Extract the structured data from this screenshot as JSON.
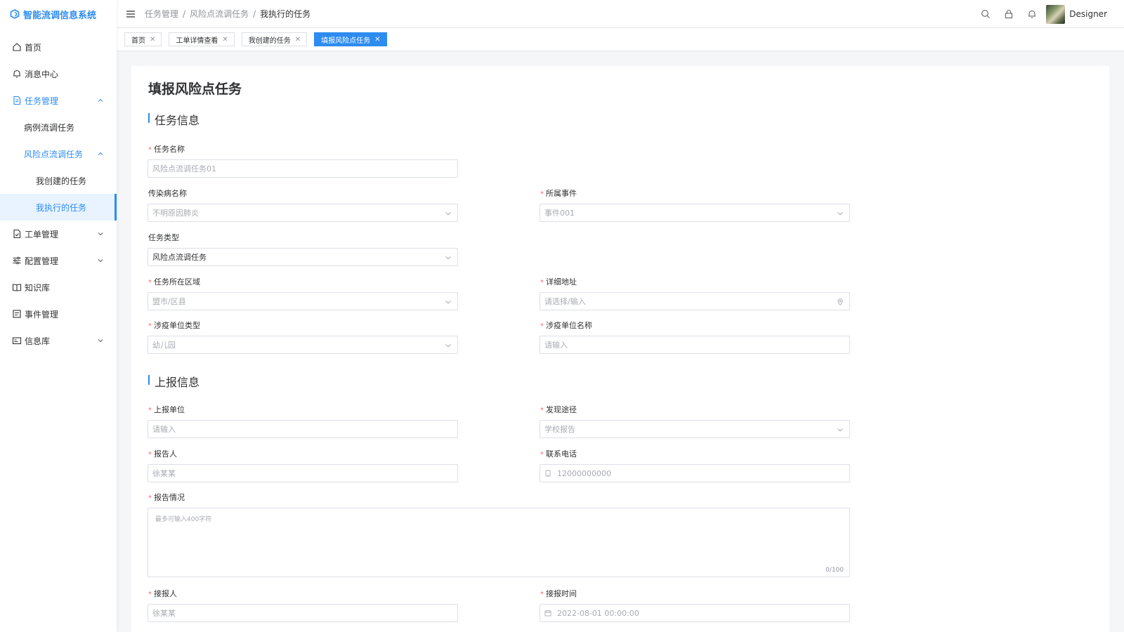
{
  "app": {
    "title": "智能流调信息系统"
  },
  "sidebar": {
    "items": [
      {
        "label": "首页",
        "icon": "home-icon"
      },
      {
        "label": "消息中心",
        "icon": "bell-icon"
      },
      {
        "label": "任务管理",
        "icon": "document-icon",
        "expanded": true
      },
      {
        "label": "病例流调任务"
      },
      {
        "label": "风险点流调任务",
        "expanded": true
      },
      {
        "label": "我创建的任务"
      },
      {
        "label": "我执行的任务",
        "selected": true
      },
      {
        "label": "工单管理",
        "icon": "order-icon"
      },
      {
        "label": "配置管理",
        "icon": "sliders-icon"
      },
      {
        "label": "知识库",
        "icon": "book-icon"
      },
      {
        "label": "事件管理",
        "icon": "event-icon"
      },
      {
        "label": "信息库",
        "icon": "card-icon"
      }
    ]
  },
  "header": {
    "breadcrumb": [
      "任务管理",
      "风险点流调任务",
      "我执行的任务"
    ],
    "username": "Designer",
    "icons": [
      "search-icon",
      "lock-icon",
      "bell-icon"
    ]
  },
  "tabs": [
    {
      "label": "首页"
    },
    {
      "label": "工单详情查看"
    },
    {
      "label": "我创建的任务"
    },
    {
      "label": "填报风险点任务",
      "active": true
    }
  ],
  "page": {
    "title": "填报风险点任务",
    "sections": {
      "task_info": "任务信息",
      "report_info": "上报信息"
    },
    "fields": {
      "task_name": {
        "label": "任务名称",
        "value": "风险点流调任务01"
      },
      "disease_name": {
        "label": "传染病名称",
        "value": "不明原因肺炎"
      },
      "event": {
        "label": "所属事件",
        "value": "事件001"
      },
      "task_type": {
        "label": "任务类型",
        "value": "风险点流调任务"
      },
      "area": {
        "label": "任务所在区域",
        "value": "盟市/区县"
      },
      "address": {
        "label": "详细地址",
        "placeholder": "请选择/输入"
      },
      "unit_type": {
        "label": "涉疫单位类型",
        "value": "幼儿园"
      },
      "unit_name": {
        "label": "涉疫单位名称",
        "placeholder": "请输入"
      },
      "report_unit": {
        "label": "上报单位",
        "placeholder": "请输入"
      },
      "discovery": {
        "label": "发现途径",
        "value": "学校报告"
      },
      "reporter": {
        "label": "报告人",
        "value": "徐某某"
      },
      "phone": {
        "label": "联系电话",
        "value": "12000000000"
      },
      "report_status": {
        "label": "报告情况",
        "placeholder": "最多可输入400字符",
        "counter": "0/100"
      },
      "receiver": {
        "label": "接报人",
        "value": "徐某某"
      },
      "receive_time": {
        "label": "接报时间",
        "value": "2022-08-01 00:00:00"
      }
    }
  },
  "colors": {
    "accent": "#2d8cf0",
    "required": "#f56c6c",
    "border": "#dcdfe6"
  }
}
